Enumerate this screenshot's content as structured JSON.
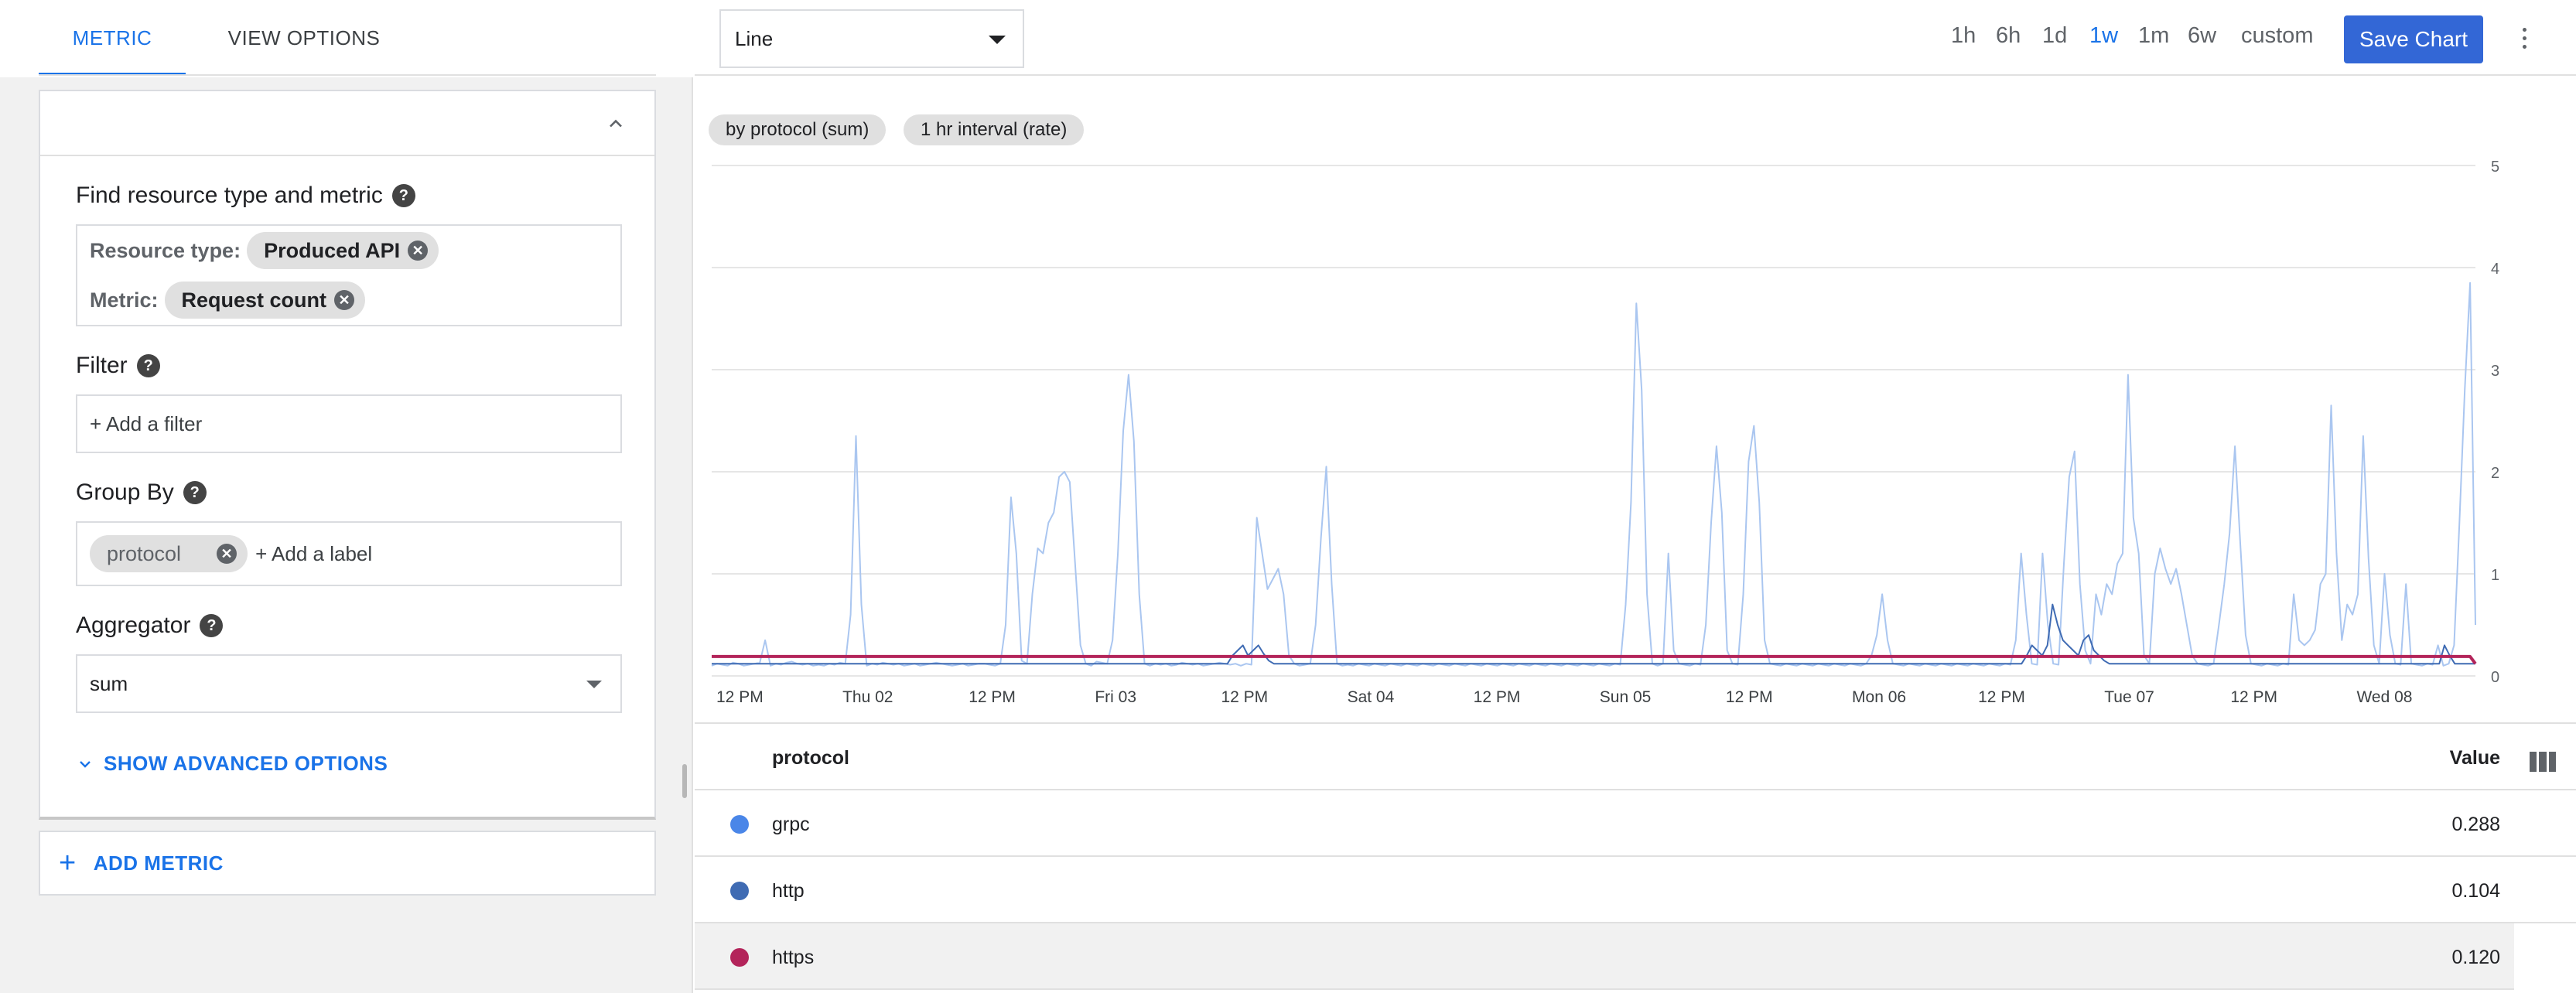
{
  "left": {
    "tabs": {
      "metric": "METRIC",
      "view_options": "VIEW OPTIONS"
    },
    "find": {
      "label": "Find resource type and metric",
      "resource_type_label": "Resource type:",
      "resource_type_value": "Produced API",
      "metric_label": "Metric:",
      "metric_value": "Request count"
    },
    "filter": {
      "label": "Filter",
      "placeholder": "+ Add a filter"
    },
    "group_by": {
      "label": "Group By",
      "chip": "protocol",
      "add_label": "+ Add a label"
    },
    "aggregator": {
      "label": "Aggregator",
      "value": "sum"
    },
    "advanced": "SHOW ADVANCED OPTIONS",
    "add_metric": "ADD METRIC"
  },
  "toolbar": {
    "chart_type": "Line",
    "ranges": [
      "1h",
      "6h",
      "1d",
      "1w",
      "1m",
      "6w",
      "custom"
    ],
    "active_range": "1w",
    "save": "Save Chart"
  },
  "chips": [
    "by protocol (sum)",
    "1 hr interval (rate)"
  ],
  "chart_data": {
    "type": "line",
    "x_tick_labels": [
      "12 PM",
      "Thu 02",
      "12 PM",
      "Fri 03",
      "12 PM",
      "Sat 04",
      "12 PM",
      "Sun 05",
      "12 PM",
      "Mon 06",
      "12 PM",
      "Tue 07",
      "12 PM",
      "Wed 08"
    ],
    "y_ticks": [
      0,
      1,
      2,
      3,
      4,
      5
    ],
    "ylim": [
      0,
      5
    ],
    "grid": true,
    "series": [
      {
        "name": "grpc",
        "color": "#aac6f0",
        "values": [
          0.1,
          0.12,
          0.11,
          0.1,
          0.13,
          0.12,
          0.1,
          0.11,
          0.12,
          0.13,
          0.35,
          0.1,
          0.12,
          0.11,
          0.13,
          0.14,
          0.12,
          0.11,
          0.12,
          0.1,
          0.11,
          0.1,
          0.12,
          0.11,
          0.13,
          0.12,
          0.6,
          2.35,
          0.7,
          0.1,
          0.12,
          0.11,
          0.13,
          0.12,
          0.11,
          0.12,
          0.1,
          0.11,
          0.12,
          0.1,
          0.11,
          0.12,
          0.13,
          0.12,
          0.11,
          0.1,
          0.11,
          0.12,
          0.1,
          0.11,
          0.12,
          0.12,
          0.11,
          0.1,
          0.12,
          0.5,
          1.75,
          1.2,
          0.15,
          0.12,
          0.8,
          1.25,
          1.2,
          1.5,
          1.6,
          1.95,
          2.0,
          1.9,
          1.1,
          0.3,
          0.12,
          0.1,
          0.14,
          0.13,
          0.12,
          0.35,
          1.2,
          2.4,
          2.95,
          2.3,
          0.8,
          0.12,
          0.1,
          0.12,
          0.11,
          0.12,
          0.1,
          0.11,
          0.13,
          0.12,
          0.11,
          0.12,
          0.1,
          0.11,
          0.12,
          0.13,
          0.12,
          0.11,
          0.12,
          0.1,
          0.12,
          0.11,
          1.55,
          1.2,
          0.85,
          0.95,
          1.05,
          0.8,
          0.2,
          0.12,
          0.1,
          0.11,
          0.12,
          0.5,
          1.35,
          2.05,
          0.9,
          0.12,
          0.1,
          0.11,
          0.1,
          0.12,
          0.11,
          0.1,
          0.12,
          0.11,
          0.1,
          0.12,
          0.11,
          0.1,
          0.12,
          0.11,
          0.1,
          0.12,
          0.11,
          0.1,
          0.12,
          0.11,
          0.1,
          0.12,
          0.11,
          0.1,
          0.12,
          0.11,
          0.1,
          0.12,
          0.11,
          0.1,
          0.12,
          0.11,
          0.1,
          0.12,
          0.11,
          0.1,
          0.12,
          0.11,
          0.1,
          0.12,
          0.11,
          0.1,
          0.12,
          0.11,
          0.1,
          0.12,
          0.11,
          0.1,
          0.12,
          0.11,
          0.1,
          0.12,
          0.11,
          0.7,
          1.7,
          3.65,
          2.8,
          0.8,
          0.12,
          0.1,
          0.12,
          1.2,
          0.25,
          0.12,
          0.11,
          0.1,
          0.12,
          0.11,
          0.5,
          1.5,
          2.25,
          1.6,
          0.25,
          0.12,
          0.11,
          0.8,
          2.1,
          2.45,
          1.7,
          0.35,
          0.12,
          0.11,
          0.1,
          0.12,
          0.11,
          0.1,
          0.12,
          0.11,
          0.1,
          0.12,
          0.11,
          0.1,
          0.12,
          0.11,
          0.1,
          0.12,
          0.11,
          0.1,
          0.12,
          0.2,
          0.4,
          0.8,
          0.35,
          0.12,
          0.11,
          0.1,
          0.12,
          0.11,
          0.1,
          0.12,
          0.11,
          0.1,
          0.12,
          0.11,
          0.1,
          0.12,
          0.11,
          0.1,
          0.12,
          0.11,
          0.1,
          0.12,
          0.11,
          0.1,
          0.12,
          0.11,
          0.35,
          1.2,
          0.6,
          0.12,
          0.11,
          1.2,
          0.5,
          0.12,
          0.11,
          1.1,
          1.95,
          2.2,
          0.9,
          0.25,
          0.12,
          0.8,
          0.6,
          0.9,
          0.8,
          1.1,
          1.2,
          2.95,
          1.55,
          1.2,
          0.2,
          0.12,
          1.0,
          1.25,
          1.05,
          0.9,
          1.05,
          0.8,
          0.5,
          0.2,
          0.12,
          0.11,
          0.1,
          0.12,
          0.5,
          0.9,
          1.4,
          2.25,
          1.3,
          0.4,
          0.12,
          0.11,
          0.1,
          0.12,
          0.11,
          0.1,
          0.12,
          0.11,
          0.8,
          0.35,
          0.3,
          0.35,
          0.45,
          0.9,
          1.0,
          2.65,
          1.2,
          0.35,
          0.7,
          0.6,
          0.8,
          2.35,
          1.15,
          0.3,
          0.12,
          1.0,
          0.4,
          0.12,
          0.11,
          0.9,
          0.12,
          0.11,
          0.1,
          0.12,
          0.11,
          0.3,
          0.1,
          0.12,
          0.3,
          1.5,
          2.8,
          3.85,
          0.5
        ]
      },
      {
        "name": "http",
        "color": "#3f6bb3",
        "values": [
          0.12,
          0.12,
          0.12,
          0.12,
          0.12,
          0.12,
          0.12,
          0.12,
          0.12,
          0.12,
          0.12,
          0.12,
          0.12,
          0.12,
          0.12,
          0.12,
          0.12,
          0.12,
          0.12,
          0.12,
          0.12,
          0.12,
          0.12,
          0.12,
          0.12,
          0.12,
          0.12,
          0.12,
          0.12,
          0.12,
          0.12,
          0.12,
          0.12,
          0.12,
          0.12,
          0.12,
          0.12,
          0.12,
          0.12,
          0.12,
          0.12,
          0.12,
          0.12,
          0.12,
          0.12,
          0.12,
          0.12,
          0.12,
          0.12,
          0.12,
          0.12,
          0.12,
          0.12,
          0.12,
          0.12,
          0.12,
          0.12,
          0.12,
          0.12,
          0.12,
          0.12,
          0.12,
          0.12,
          0.12,
          0.12,
          0.12,
          0.12,
          0.12,
          0.12,
          0.12,
          0.12,
          0.12,
          0.12,
          0.12,
          0.12,
          0.12,
          0.12,
          0.12,
          0.12,
          0.12,
          0.12,
          0.12,
          0.12,
          0.12,
          0.12,
          0.12,
          0.12,
          0.12,
          0.12,
          0.12,
          0.12,
          0.12,
          0.12,
          0.12,
          0.12,
          0.12,
          0.12,
          0.12,
          0.12,
          0.12,
          0.12,
          0.2,
          0.25,
          0.3,
          0.2,
          0.25,
          0.3,
          0.22,
          0.15,
          0.12,
          0.12,
          0.12,
          0.12,
          0.12,
          0.12,
          0.12,
          0.12,
          0.12,
          0.12,
          0.12,
          0.12,
          0.12,
          0.12,
          0.12,
          0.12,
          0.12,
          0.12,
          0.12,
          0.12,
          0.12,
          0.12,
          0.12,
          0.12,
          0.12,
          0.12,
          0.12,
          0.12,
          0.12,
          0.12,
          0.12,
          0.12,
          0.12,
          0.12,
          0.12,
          0.12,
          0.12,
          0.12,
          0.12,
          0.12,
          0.12,
          0.12,
          0.12,
          0.12,
          0.12,
          0.12,
          0.12,
          0.12,
          0.12,
          0.12,
          0.12,
          0.12,
          0.12,
          0.12,
          0.12,
          0.12,
          0.12,
          0.12,
          0.12,
          0.12,
          0.12,
          0.12,
          0.12,
          0.12,
          0.12,
          0.12,
          0.12,
          0.12,
          0.12,
          0.12,
          0.12,
          0.12,
          0.12,
          0.12,
          0.12,
          0.12,
          0.12,
          0.12,
          0.12,
          0.12,
          0.12,
          0.12,
          0.12,
          0.12,
          0.12,
          0.12,
          0.12,
          0.12,
          0.12,
          0.12,
          0.12,
          0.12,
          0.12,
          0.12,
          0.12,
          0.12,
          0.12,
          0.12,
          0.12,
          0.12,
          0.12,
          0.12,
          0.12,
          0.12,
          0.12,
          0.12,
          0.12,
          0.12,
          0.12,
          0.12,
          0.12,
          0.12,
          0.12,
          0.12,
          0.12,
          0.12,
          0.12,
          0.12,
          0.12,
          0.12,
          0.12,
          0.12,
          0.12,
          0.12,
          0.12,
          0.12,
          0.12,
          0.12,
          0.12,
          0.12,
          0.12,
          0.12,
          0.12,
          0.12,
          0.12,
          0.12,
          0.12,
          0.12,
          0.12,
          0.12,
          0.12,
          0.12,
          0.12,
          0.12,
          0.12,
          0.12,
          0.2,
          0.3,
          0.25,
          0.2,
          0.3,
          0.7,
          0.5,
          0.35,
          0.3,
          0.25,
          0.2,
          0.35,
          0.4,
          0.25,
          0.2,
          0.15,
          0.12,
          0.12,
          0.12,
          0.12,
          0.12,
          0.12,
          0.12,
          0.12,
          0.12,
          0.12,
          0.12,
          0.12,
          0.12,
          0.12,
          0.12,
          0.12,
          0.12,
          0.12,
          0.12,
          0.12,
          0.12,
          0.12,
          0.12,
          0.12,
          0.12,
          0.12,
          0.12,
          0.12,
          0.12,
          0.12,
          0.12,
          0.12,
          0.12,
          0.12,
          0.12,
          0.12,
          0.12,
          0.12,
          0.12,
          0.12,
          0.12,
          0.12,
          0.12,
          0.12,
          0.12,
          0.12,
          0.12,
          0.12,
          0.12,
          0.12,
          0.12,
          0.12,
          0.12,
          0.12,
          0.12,
          0.12,
          0.12,
          0.12,
          0.12,
          0.12,
          0.12,
          0.12,
          0.12,
          0.12,
          0.12,
          0.3,
          0.2,
          0.12,
          0.12,
          0.12,
          0.12,
          0.12
        ]
      },
      {
        "name": "https",
        "color": "#b3245a",
        "values": [
          0.19,
          0.19,
          0.19,
          0.19,
          0.19,
          0.19,
          0.19,
          0.19,
          0.19,
          0.19,
          0.19,
          0.19,
          0.19,
          0.19,
          0.19,
          0.19,
          0.19,
          0.19,
          0.19,
          0.19,
          0.19,
          0.19,
          0.19,
          0.19,
          0.19,
          0.19,
          0.19,
          0.19,
          0.19,
          0.19,
          0.19,
          0.19,
          0.19,
          0.19,
          0.19,
          0.19,
          0.19,
          0.19,
          0.19,
          0.19,
          0.19,
          0.19,
          0.19,
          0.19,
          0.19,
          0.19,
          0.19,
          0.19,
          0.19,
          0.19,
          0.19,
          0.19,
          0.19,
          0.19,
          0.19,
          0.19,
          0.19,
          0.19,
          0.19,
          0.19,
          0.19,
          0.19,
          0.19,
          0.19,
          0.19,
          0.19,
          0.19,
          0.19,
          0.19,
          0.19,
          0.19,
          0.19,
          0.19,
          0.19,
          0.19,
          0.19,
          0.19,
          0.19,
          0.19,
          0.19,
          0.19,
          0.19,
          0.19,
          0.19,
          0.19,
          0.19,
          0.19,
          0.19,
          0.19,
          0.19,
          0.19,
          0.19,
          0.19,
          0.19,
          0.19,
          0.19,
          0.19,
          0.19,
          0.19,
          0.19,
          0.19,
          0.19,
          0.19,
          0.19,
          0.19,
          0.19,
          0.19,
          0.19,
          0.19,
          0.19,
          0.19,
          0.19,
          0.19,
          0.19,
          0.19,
          0.19,
          0.19,
          0.19,
          0.19,
          0.19,
          0.19,
          0.19,
          0.19,
          0.19,
          0.19,
          0.19,
          0.19,
          0.19,
          0.19,
          0.19,
          0.19,
          0.19,
          0.19,
          0.19,
          0.19,
          0.19,
          0.19,
          0.19,
          0.19,
          0.19,
          0.19,
          0.19,
          0.19,
          0.19,
          0.19,
          0.19,
          0.19,
          0.19,
          0.19,
          0.19,
          0.19,
          0.19,
          0.19,
          0.19,
          0.19,
          0.19,
          0.19,
          0.19,
          0.19,
          0.19,
          0.19,
          0.19,
          0.19,
          0.19,
          0.19,
          0.19,
          0.19,
          0.19,
          0.19,
          0.19,
          0.19,
          0.19,
          0.19,
          0.19,
          0.19,
          0.19,
          0.19,
          0.19,
          0.19,
          0.19,
          0.19,
          0.19,
          0.19,
          0.19,
          0.19,
          0.19,
          0.19,
          0.19,
          0.19,
          0.19,
          0.19,
          0.19,
          0.19,
          0.19,
          0.19,
          0.19,
          0.19,
          0.19,
          0.19,
          0.19,
          0.19,
          0.19,
          0.19,
          0.19,
          0.19,
          0.19,
          0.19,
          0.19,
          0.19,
          0.19,
          0.19,
          0.19,
          0.19,
          0.19,
          0.19,
          0.19,
          0.19,
          0.19,
          0.19,
          0.19,
          0.19,
          0.19,
          0.19,
          0.19,
          0.19,
          0.19,
          0.19,
          0.19,
          0.19,
          0.19,
          0.19,
          0.19,
          0.19,
          0.19,
          0.19,
          0.19,
          0.19,
          0.19,
          0.19,
          0.19,
          0.19,
          0.19,
          0.19,
          0.19,
          0.19,
          0.19,
          0.19,
          0.19,
          0.19,
          0.19,
          0.19,
          0.19,
          0.19,
          0.19,
          0.19,
          0.19,
          0.19,
          0.19,
          0.19,
          0.19,
          0.19,
          0.19,
          0.19,
          0.19,
          0.19,
          0.19,
          0.19,
          0.19,
          0.19,
          0.19,
          0.19,
          0.19,
          0.19,
          0.19,
          0.19,
          0.19,
          0.19,
          0.19,
          0.19,
          0.19,
          0.19,
          0.19,
          0.19,
          0.19,
          0.19,
          0.19,
          0.19,
          0.19,
          0.19,
          0.19,
          0.19,
          0.19,
          0.19,
          0.19,
          0.19,
          0.19,
          0.19,
          0.19,
          0.19,
          0.19,
          0.19,
          0.19,
          0.19,
          0.19,
          0.19,
          0.19,
          0.19,
          0.19,
          0.19,
          0.19,
          0.19,
          0.19,
          0.19,
          0.19,
          0.19,
          0.19,
          0.19,
          0.19,
          0.19,
          0.19,
          0.19,
          0.19,
          0.19,
          0.19,
          0.19,
          0.19,
          0.19,
          0.19,
          0.19,
          0.19,
          0.12
        ]
      }
    ]
  },
  "table": {
    "header_protocol": "protocol",
    "header_value": "Value",
    "rows": [
      {
        "name": "grpc",
        "value": "0.288",
        "color": "#4a86e8"
      },
      {
        "name": "http",
        "value": "0.104",
        "color": "#3f6bb3"
      },
      {
        "name": "https",
        "value": "0.120",
        "color": "#b3245a"
      }
    ]
  }
}
